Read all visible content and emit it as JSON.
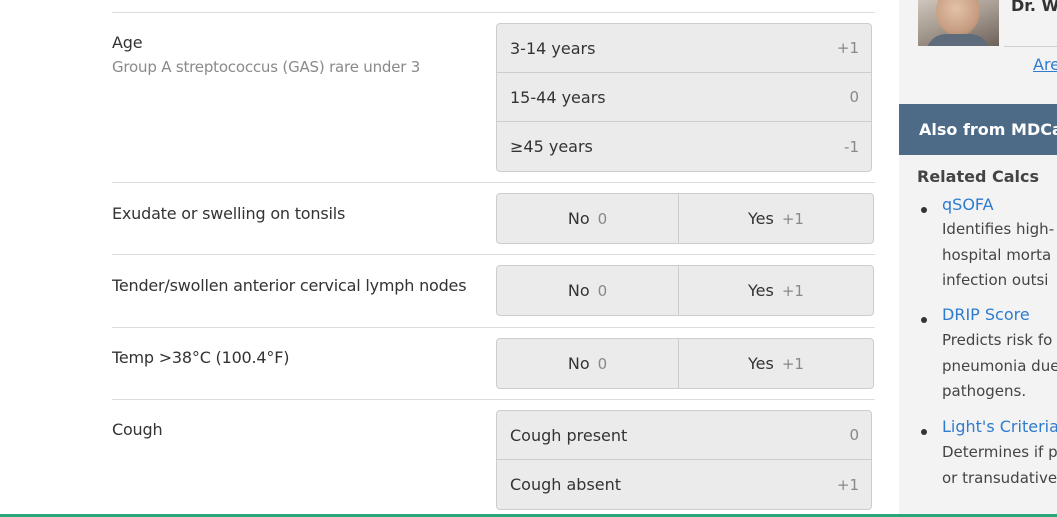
{
  "questions": {
    "age": {
      "label": "Age",
      "sub": "Group A streptococcus (GAS) rare under 3",
      "options": [
        {
          "label": "3-14 years",
          "points": "+1"
        },
        {
          "label": "15-44 years",
          "points": "0"
        },
        {
          "label": "≥45 years",
          "points": "-1"
        }
      ]
    },
    "exudate": {
      "label": "Exudate or swelling on tonsils",
      "no": "No",
      "no_pts": "0",
      "yes": "Yes",
      "yes_pts": "+1"
    },
    "nodes": {
      "label": "Tender/swollen anterior cervical lymph nodes",
      "no": "No",
      "no_pts": "0",
      "yes": "Yes",
      "yes_pts": "+1"
    },
    "temp": {
      "label": "Temp >38°C (100.4°F)",
      "no": "No",
      "no_pts": "0",
      "yes": "Yes",
      "yes_pts": "+1"
    },
    "cough": {
      "label": "Cough",
      "options": [
        {
          "label": "Cough present",
          "points": "0"
        },
        {
          "label": "Cough absent",
          "points": "+1"
        }
      ]
    }
  },
  "sidebar": {
    "doctor_name": "Dr. Wa",
    "are_link": "Are",
    "also_header": "Also from MDCalc",
    "related_title": "Related Calcs",
    "related": [
      {
        "name": "qSOFA",
        "desc": "Identifies high-\nhospital morta\ninfection outsi"
      },
      {
        "name": "DRIP Score",
        "desc": "Predicts risk fo\npneumonia due\npathogens."
      },
      {
        "name": "Light's Criteria",
        "desc": "Determines if p\nor transudative"
      }
    ]
  },
  "colors": {
    "accent": "#2e7bcf",
    "header_bg": "#4d6a86",
    "bottom_bar": "#2aa67a"
  }
}
